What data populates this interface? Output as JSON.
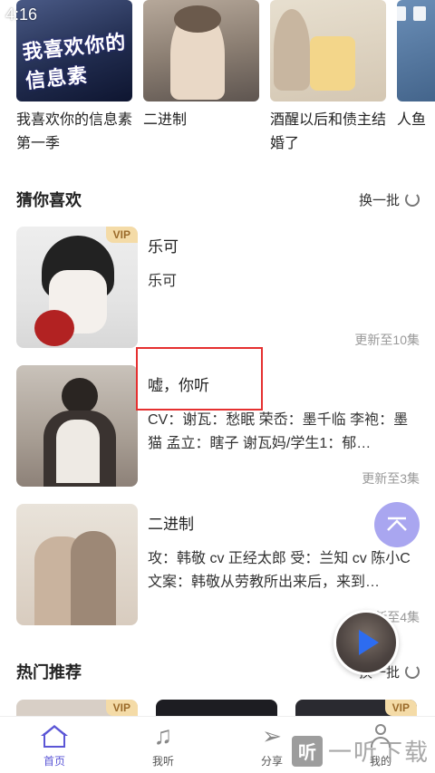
{
  "status": {
    "time": "4:16"
  },
  "top_row": {
    "items": [
      {
        "title": "我喜欢你的信息素 第一季",
        "cover_text": "我喜欢你的信息素"
      },
      {
        "title": "二进制"
      },
      {
        "title": "酒醒以后和债主结婚了"
      },
      {
        "title": "人鱼"
      }
    ]
  },
  "guess": {
    "title": "猜你喜欢",
    "refresh_label": "换一批",
    "items": [
      {
        "title": "乐可",
        "desc": "乐可",
        "update": "更新至10集",
        "vip": "VIP"
      },
      {
        "title": "嘘，你听",
        "desc": "CV：谢瓦：愁眠 荣岙：墨千临 李袍：墨猫 孟立：瞎子 谢瓦妈/学生1：郁…",
        "update": "更新至3集"
      },
      {
        "title": "二进制",
        "desc": "攻：韩敬 cv 正经太郎 受：兰知 cv 陈小C 文案：韩敬从劳教所出来后，来到…",
        "update": "更新至4集"
      }
    ]
  },
  "hot": {
    "title": "热门推荐",
    "refresh_label": "换一批",
    "vip": "VIP"
  },
  "tabs": [
    {
      "label": "首页",
      "icon": "home-icon"
    },
    {
      "label": "我听",
      "icon": "music-note-icon"
    },
    {
      "label": "分享",
      "icon": "send-icon"
    },
    {
      "label": "我的",
      "icon": "user-icon"
    }
  ],
  "watermark": {
    "badge": "听",
    "text": "一听下载"
  },
  "colors": {
    "accent": "#5b56d6",
    "highlight": "#e53030",
    "vip_bg": "#f4dba7",
    "fab": "#a9a6f0"
  }
}
